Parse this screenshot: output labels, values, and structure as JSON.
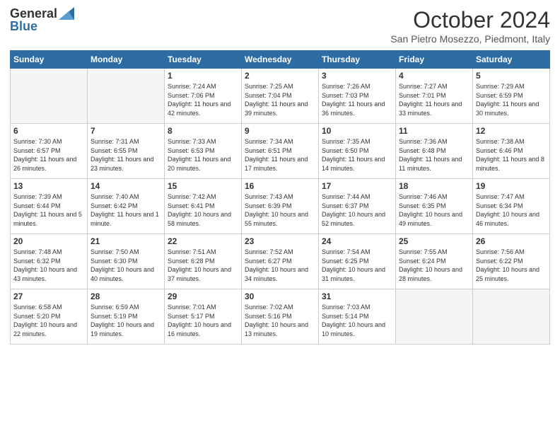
{
  "header": {
    "logo_general": "General",
    "logo_blue": "Blue",
    "month_title": "October 2024",
    "location": "San Pietro Mosezzo, Piedmont, Italy"
  },
  "weekdays": [
    "Sunday",
    "Monday",
    "Tuesday",
    "Wednesday",
    "Thursday",
    "Friday",
    "Saturday"
  ],
  "weeks": [
    [
      {
        "day": "",
        "info": ""
      },
      {
        "day": "",
        "info": ""
      },
      {
        "day": "1",
        "info": "Sunrise: 7:24 AM\nSunset: 7:06 PM\nDaylight: 11 hours and 42 minutes."
      },
      {
        "day": "2",
        "info": "Sunrise: 7:25 AM\nSunset: 7:04 PM\nDaylight: 11 hours and 39 minutes."
      },
      {
        "day": "3",
        "info": "Sunrise: 7:26 AM\nSunset: 7:03 PM\nDaylight: 11 hours and 36 minutes."
      },
      {
        "day": "4",
        "info": "Sunrise: 7:27 AM\nSunset: 7:01 PM\nDaylight: 11 hours and 33 minutes."
      },
      {
        "day": "5",
        "info": "Sunrise: 7:29 AM\nSunset: 6:59 PM\nDaylight: 11 hours and 30 minutes."
      }
    ],
    [
      {
        "day": "6",
        "info": "Sunrise: 7:30 AM\nSunset: 6:57 PM\nDaylight: 11 hours and 26 minutes."
      },
      {
        "day": "7",
        "info": "Sunrise: 7:31 AM\nSunset: 6:55 PM\nDaylight: 11 hours and 23 minutes."
      },
      {
        "day": "8",
        "info": "Sunrise: 7:33 AM\nSunset: 6:53 PM\nDaylight: 11 hours and 20 minutes."
      },
      {
        "day": "9",
        "info": "Sunrise: 7:34 AM\nSunset: 6:51 PM\nDaylight: 11 hours and 17 minutes."
      },
      {
        "day": "10",
        "info": "Sunrise: 7:35 AM\nSunset: 6:50 PM\nDaylight: 11 hours and 14 minutes."
      },
      {
        "day": "11",
        "info": "Sunrise: 7:36 AM\nSunset: 6:48 PM\nDaylight: 11 hours and 11 minutes."
      },
      {
        "day": "12",
        "info": "Sunrise: 7:38 AM\nSunset: 6:46 PM\nDaylight: 11 hours and 8 minutes."
      }
    ],
    [
      {
        "day": "13",
        "info": "Sunrise: 7:39 AM\nSunset: 6:44 PM\nDaylight: 11 hours and 5 minutes."
      },
      {
        "day": "14",
        "info": "Sunrise: 7:40 AM\nSunset: 6:42 PM\nDaylight: 11 hours and 1 minute."
      },
      {
        "day": "15",
        "info": "Sunrise: 7:42 AM\nSunset: 6:41 PM\nDaylight: 10 hours and 58 minutes."
      },
      {
        "day": "16",
        "info": "Sunrise: 7:43 AM\nSunset: 6:39 PM\nDaylight: 10 hours and 55 minutes."
      },
      {
        "day": "17",
        "info": "Sunrise: 7:44 AM\nSunset: 6:37 PM\nDaylight: 10 hours and 52 minutes."
      },
      {
        "day": "18",
        "info": "Sunrise: 7:46 AM\nSunset: 6:35 PM\nDaylight: 10 hours and 49 minutes."
      },
      {
        "day": "19",
        "info": "Sunrise: 7:47 AM\nSunset: 6:34 PM\nDaylight: 10 hours and 46 minutes."
      }
    ],
    [
      {
        "day": "20",
        "info": "Sunrise: 7:48 AM\nSunset: 6:32 PM\nDaylight: 10 hours and 43 minutes."
      },
      {
        "day": "21",
        "info": "Sunrise: 7:50 AM\nSunset: 6:30 PM\nDaylight: 10 hours and 40 minutes."
      },
      {
        "day": "22",
        "info": "Sunrise: 7:51 AM\nSunset: 6:28 PM\nDaylight: 10 hours and 37 minutes."
      },
      {
        "day": "23",
        "info": "Sunrise: 7:52 AM\nSunset: 6:27 PM\nDaylight: 10 hours and 34 minutes."
      },
      {
        "day": "24",
        "info": "Sunrise: 7:54 AM\nSunset: 6:25 PM\nDaylight: 10 hours and 31 minutes."
      },
      {
        "day": "25",
        "info": "Sunrise: 7:55 AM\nSunset: 6:24 PM\nDaylight: 10 hours and 28 minutes."
      },
      {
        "day": "26",
        "info": "Sunrise: 7:56 AM\nSunset: 6:22 PM\nDaylight: 10 hours and 25 minutes."
      }
    ],
    [
      {
        "day": "27",
        "info": "Sunrise: 6:58 AM\nSunset: 5:20 PM\nDaylight: 10 hours and 22 minutes."
      },
      {
        "day": "28",
        "info": "Sunrise: 6:59 AM\nSunset: 5:19 PM\nDaylight: 10 hours and 19 minutes."
      },
      {
        "day": "29",
        "info": "Sunrise: 7:01 AM\nSunset: 5:17 PM\nDaylight: 10 hours and 16 minutes."
      },
      {
        "day": "30",
        "info": "Sunrise: 7:02 AM\nSunset: 5:16 PM\nDaylight: 10 hours and 13 minutes."
      },
      {
        "day": "31",
        "info": "Sunrise: 7:03 AM\nSunset: 5:14 PM\nDaylight: 10 hours and 10 minutes."
      },
      {
        "day": "",
        "info": ""
      },
      {
        "day": "",
        "info": ""
      }
    ]
  ]
}
